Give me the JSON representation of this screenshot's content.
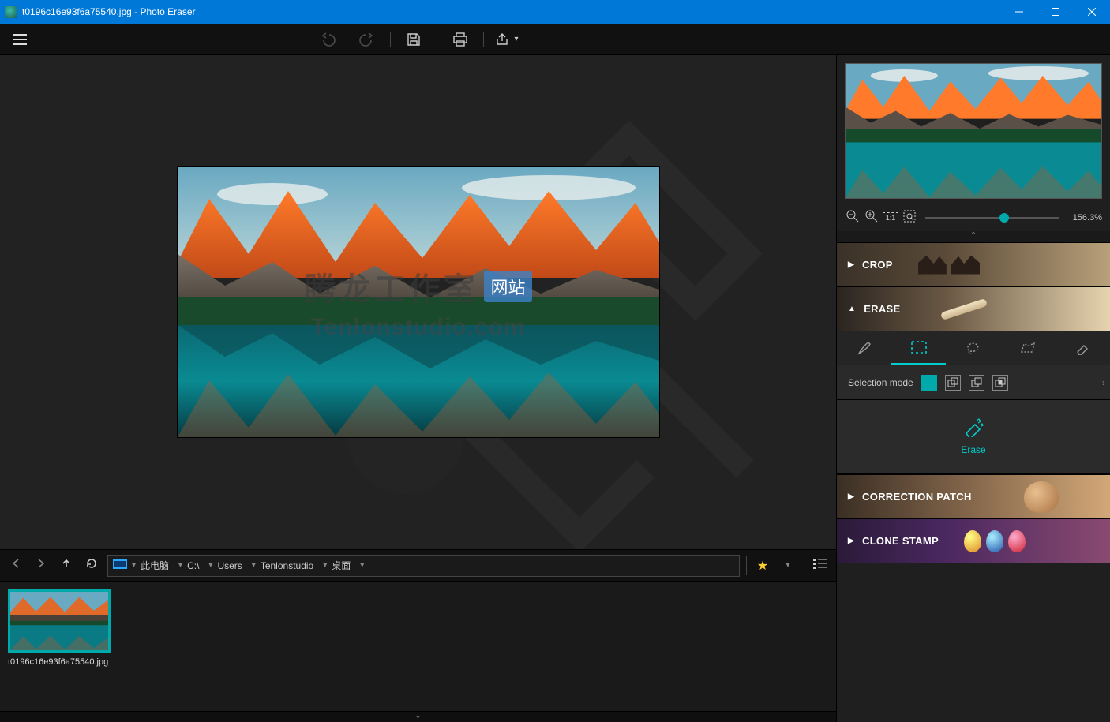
{
  "titlebar": {
    "filename": "t0196c16e93f6a75540.jpg",
    "app_name": "Photo Eraser",
    "separator": " - "
  },
  "toolbar": {
    "menu": "menu",
    "undo": "undo",
    "redo": "redo",
    "save": "save",
    "print": "print",
    "share": "share"
  },
  "watermark": {
    "cn_line": "腾龙工作室",
    "badge": "网站",
    "domain": "Tenlonstudio.com"
  },
  "breadcrumb": {
    "segments": [
      "此电脑",
      "C:\\",
      "Users",
      "Tenlonstudio",
      "桌面"
    ]
  },
  "filmstrip": {
    "thumb_label": "t0196c16e93f6a75540.jpg"
  },
  "right": {
    "zoom_label": "156.3%",
    "sections": {
      "crop": "CROP",
      "erase": "ERASE",
      "correction": "CORRECTION PATCH",
      "clone": "CLONE STAMP"
    },
    "selection_mode_label": "Selection mode",
    "erase_button": "Erase"
  }
}
